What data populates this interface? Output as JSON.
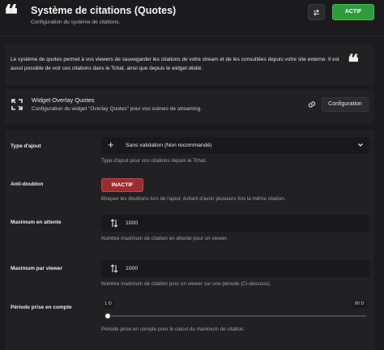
{
  "header": {
    "title": "Système de citations (Quotes)",
    "subtitle": "Configuration du système de citations.",
    "logo_glyph": "❝",
    "swap_icon": "swap-arrows-icon",
    "status_label": "ACTIF",
    "status_color": "#2d9b3e"
  },
  "info": {
    "text": "Le système de quotes permet à vos viewers de sauvegarder les citations de votre stream et de les consultées depuis votre site externe. Il est aussi possible de voir ces citations dans le Tchat, ainsi que depuis le widget dédié.",
    "quote_glyph": "❝"
  },
  "widget": {
    "title": "Widget Overlay Quotes",
    "description": "Configuration du widget \"Overlay Quotes\" pour vos scènes de streaming.",
    "config_label": "Configuration"
  },
  "settings": {
    "type_ajout": {
      "label": "Type d'ajout",
      "value": "Sans validation (Non recommandé)",
      "help": "Type d'ajout pour vos citations depuis le Tchat."
    },
    "anti_doublon": {
      "label": "Anti-doublon",
      "state_label": "INACTIF",
      "state_color": "#9a2d2d",
      "help": "Bloquer les doublons lors de l'ajout, évitant d'avoir plusieurs fois la même citation."
    },
    "max_attente": {
      "label": "Maximum en attente",
      "value": "1000",
      "help": "Nombre maximum de citation en attente pour un viewer."
    },
    "max_viewer": {
      "label": "Maximum par viewer",
      "value": "1000",
      "help": "Nombre maximum de citation pour un viewer sur une période (Ci-dessous)."
    },
    "periode": {
      "label": "Période prise en compte",
      "min_label": "1 D",
      "max_label": "90 D",
      "value_fraction": 0,
      "help": "Période prise en compte pour le calcul du maximum de citation."
    }
  }
}
